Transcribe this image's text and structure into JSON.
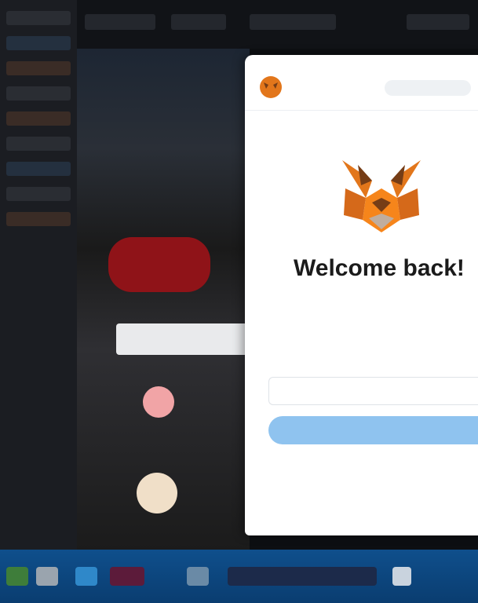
{
  "popup": {
    "header_link": "",
    "title": "Welcome back!",
    "subtitle": "",
    "password_label": "",
    "password_placeholder": "",
    "unlock_label": "",
    "forgot_label": "",
    "help_text": ""
  },
  "taskbar": {
    "tray_text": ""
  },
  "icons": {
    "small_fox": "metamask-fox-icon",
    "big_fox": "metamask-fox-logo",
    "colors": {
      "fox_orange": "#e2761b",
      "fox_dark": "#763d16",
      "button_blue": "#8fc3ef",
      "taskbar_blue": "#0f4f8c"
    }
  }
}
